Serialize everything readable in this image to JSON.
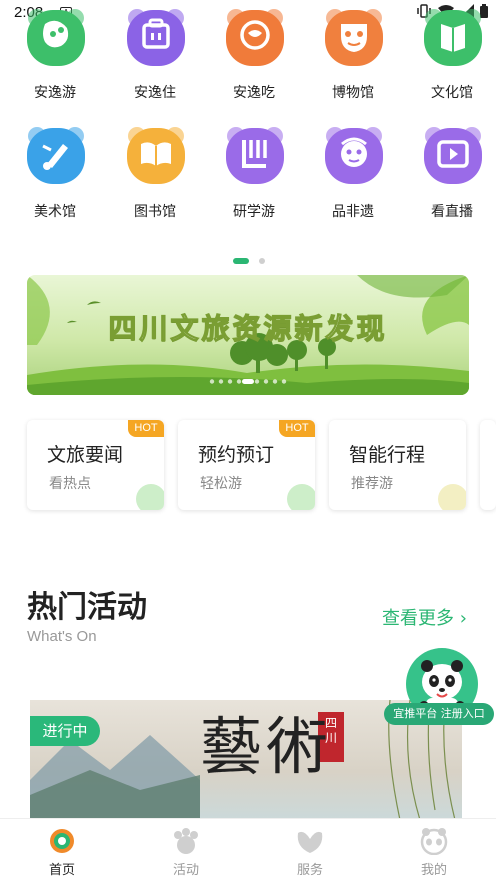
{
  "status_bar": {
    "time": "2:08",
    "badge": "A"
  },
  "icon_grid": {
    "rows": [
      [
        {
          "label": "安逸游",
          "icon": "smile-bubble-icon",
          "color": "#3dbf6a"
        },
        {
          "label": "安逸住",
          "icon": "bed-icon",
          "color": "#8b63e6"
        },
        {
          "label": "安逸吃",
          "icon": "food-icon",
          "color": "#f07b3a"
        },
        {
          "label": "博物馆",
          "icon": "opera-mask-icon",
          "color": "#f0803e"
        },
        {
          "label": "文化馆",
          "icon": "book-icon",
          "color": "#3dbf6a"
        }
      ],
      [
        {
          "label": "美术馆",
          "icon": "paintbrush-icon",
          "color": "#3aa2e8"
        },
        {
          "label": "图书馆",
          "icon": "open-book-icon",
          "color": "#f5b13b"
        },
        {
          "label": "研学游",
          "icon": "study-icon",
          "color": "#9a6be8"
        },
        {
          "label": "品非遗",
          "icon": "heritage-mask-icon",
          "color": "#9a6be8"
        },
        {
          "label": "看直播",
          "icon": "play-icon",
          "color": "#9a6be8"
        }
      ]
    ]
  },
  "pager": {
    "pages": 2,
    "active": 1
  },
  "banner": {
    "title": "四川文旅资源新发现",
    "slides": 9,
    "active_slide": 4
  },
  "cards": [
    {
      "title": "文旅要闻",
      "sub": "看热点",
      "hot": "HOT",
      "accent": "#cdeec9"
    },
    {
      "title": "预约预订",
      "sub": "轻松游",
      "hot": "HOT",
      "accent": "#cdeec9"
    },
    {
      "title": "智能行程",
      "sub": "推荐游",
      "hot": "",
      "accent": "#f3efc3"
    }
  ],
  "section": {
    "title": "热门活动",
    "subtitle": "What's On",
    "more": "查看更多 ›"
  },
  "fab": {
    "pill": "宜推平台 注册入口"
  },
  "event": {
    "badge": "进行中",
    "chars": "藝術",
    "seal": "四川"
  },
  "tabbar": [
    {
      "label": "首页",
      "icon": "home-logo-icon",
      "active": true
    },
    {
      "label": "活动",
      "icon": "panda-paw-icon",
      "active": false
    },
    {
      "label": "服务",
      "icon": "hands-heart-icon",
      "active": false
    },
    {
      "label": "我的",
      "icon": "panda-face-icon",
      "active": false
    }
  ],
  "colors": {
    "accent": "#2bb673",
    "hot": "#f5a623"
  }
}
